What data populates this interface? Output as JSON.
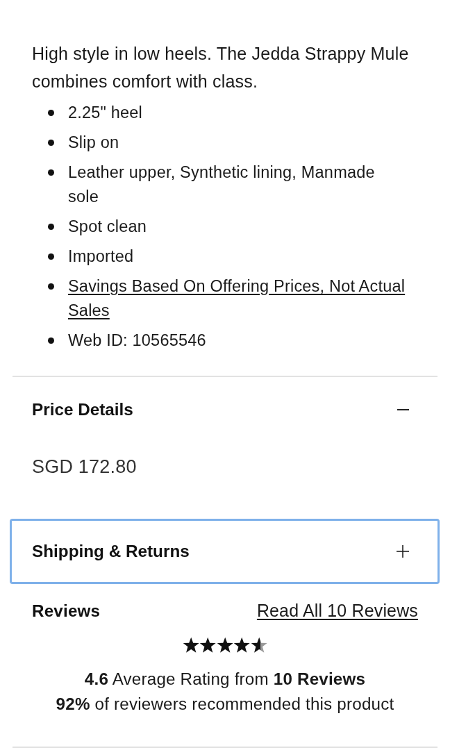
{
  "description": "High style in low heels. The Jedda Strappy Mule combines comfort with class.",
  "features": [
    {
      "kind": "text",
      "text": "2.25\" heel"
    },
    {
      "kind": "text",
      "text": "Slip on"
    },
    {
      "kind": "text",
      "text": "Leather upper, Synthetic lining, Manmade sole"
    },
    {
      "kind": "text",
      "text": "Spot clean"
    },
    {
      "kind": "text",
      "text": "Imported"
    },
    {
      "kind": "link",
      "text": "Savings Based On Offering Prices, Not Actual Sales"
    },
    {
      "kind": "text",
      "text": "Web ID: 10565546"
    }
  ],
  "sections": [
    {
      "title": "Price Details",
      "expanded": true,
      "focused": false,
      "price": "SGD 172.80"
    },
    {
      "title": "Shipping & Returns",
      "expanded": false,
      "focused": true
    }
  ],
  "reviews": {
    "title": "Reviews",
    "link": "Read All 10 Reviews",
    "stars": 4.6,
    "summary": "**4.6** Average Rating from **10 Reviews**",
    "recommendation": "**92%** of reviewers recommended this product"
  }
}
